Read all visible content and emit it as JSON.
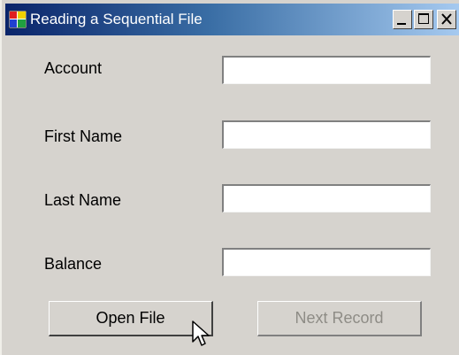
{
  "window": {
    "title": "Reading a Sequential File",
    "controls": {
      "minimize": "minimize-icon",
      "maximize": "maximize-icon",
      "close": "close-icon"
    }
  },
  "fields": [
    {
      "label": "Account",
      "value": ""
    },
    {
      "label": "First Name",
      "value": ""
    },
    {
      "label": "Last Name",
      "value": ""
    },
    {
      "label": "Balance",
      "value": ""
    }
  ],
  "buttons": {
    "open_file": "Open File",
    "next_record": "Next Record",
    "next_record_enabled": false
  },
  "colors": {
    "titlebar_start": "#0a246a",
    "titlebar_end": "#a6caf0",
    "window_bg": "#d6d3ce",
    "disabled_text": "#8e8c86"
  }
}
